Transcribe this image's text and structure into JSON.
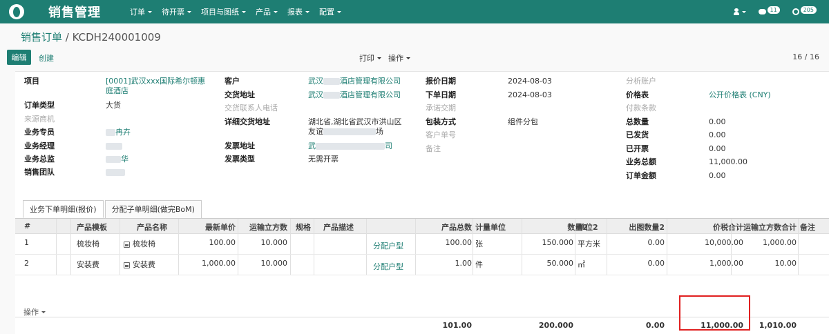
{
  "nav": {
    "app_title": "销售管理",
    "menus": [
      "订单",
      "待开票",
      "项目与图纸",
      "产品",
      "报表",
      "配置"
    ],
    "messages_count": "11",
    "activities_count": "205"
  },
  "breadcrumb": {
    "parent": "销售订单",
    "separator": "/",
    "current": "KCDH240001009"
  },
  "toolbar": {
    "edit": "编辑",
    "create": "创建",
    "print": "打印",
    "action": "操作",
    "pager": "16 / 16"
  },
  "form": {
    "col1": {
      "project_label": "项目",
      "project_value_line1": "[0001]武汉xxx国际希尔顿惠",
      "project_value_line2": "庭酒店",
      "order_type_label": "订单类型",
      "order_type_value": "大货",
      "source_label": "来源商机",
      "salesperson_label": "业务专员",
      "salesperson_value": "冉卉",
      "manager_label": "业务经理",
      "director_label": "业务总监",
      "director_value": "华",
      "team_label": "销售团队"
    },
    "col2": {
      "customer_label": "客户",
      "customer_value_a": "武汉",
      "customer_value_b": "酒店管理有限公司",
      "delivery_label": "交货地址",
      "delivery_value_a": "武汉",
      "delivery_value_b": "酒店管理有限公司",
      "delivery_phone_label": "交货联系人电话",
      "detail_addr_label": "详细交货地址",
      "detail_addr_line1": "湖北省,湖北省武汉市洪山区",
      "detail_addr_line2_a": "友谊",
      "detail_addr_line2_b": "场",
      "invoice_addr_label": "发票地址",
      "invoice_addr_a": "武",
      "invoice_addr_b": "司",
      "invoice_type_label": "发票类型",
      "invoice_type_value": "无需开票"
    },
    "col3": {
      "quote_date_label": "报价日期",
      "quote_date_value": "2024-08-03",
      "order_date_label": "下单日期",
      "order_date_value": "2024-08-03",
      "promise_label": "承诺交期",
      "packing_label": "包装方式",
      "packing_value": "组件分包",
      "cust_no_label": "客户单号",
      "note_label": "备注"
    },
    "col4": {
      "analytic_label": "分析账户",
      "pricelist_label": "价格表",
      "pricelist_value": "公开价格表 (CNY)",
      "payment_label": "付款条款",
      "total_qty_label": "总数量",
      "total_qty_value": "0.00",
      "shipped_label": "已发货",
      "shipped_value": "0.00",
      "invoiced_label": "已开票",
      "invoiced_value": "0.00",
      "biz_total_label": "业务总额",
      "biz_total_value": "11,000.00",
      "order_amount_label": "订单金额",
      "order_amount_value": "0.00"
    }
  },
  "tabs": [
    "业务下单明细(报价)",
    "分配子单明细(做完BoM)"
  ],
  "table": {
    "headers": {
      "idx": "#",
      "template": "产品模板",
      "name": "产品名称",
      "latest_price": "最新单价",
      "volume": "运输立方数",
      "spec": "规格",
      "desc": "产品描述",
      "qty": "产品总数",
      "uom": "计量单位",
      "qty2": "数量2",
      "uom2": "单位2",
      "out_qty2": "出图数量2",
      "tax_total": "价税合计",
      "volume_total": "运输立方数合计",
      "remark": "备注"
    },
    "rows": [
      {
        "idx": "1",
        "template": "梳妆椅",
        "name": "梳妆椅",
        "latest_price": "100.00",
        "volume": "10.000",
        "assign": "分配户型",
        "qty": "100.00",
        "uom": "张",
        "qty2": "150.000",
        "uom2": "平方米",
        "out_qty2": "0.00",
        "tax_total": "10,000.00",
        "volume_total": "1,000.00"
      },
      {
        "idx": "2",
        "template": "安装费",
        "name": "安装费",
        "latest_price": "1,000.00",
        "volume": "10.000",
        "assign": "分配户型",
        "qty": "1.00",
        "uom": "件",
        "qty2": "50.000",
        "uom2": "㎡",
        "out_qty2": "0.00",
        "tax_total": "1,000.00",
        "volume_total": "10.00"
      }
    ],
    "row_actions": "操作",
    "footer": {
      "qty": "101.00",
      "qty2": "200.000",
      "out_qty2": "0.00",
      "tax_total": "11,000.00",
      "volume_total": "1,010.00"
    }
  },
  "colors": {
    "brand": "#1e7e73",
    "highlight": "#e02020"
  }
}
